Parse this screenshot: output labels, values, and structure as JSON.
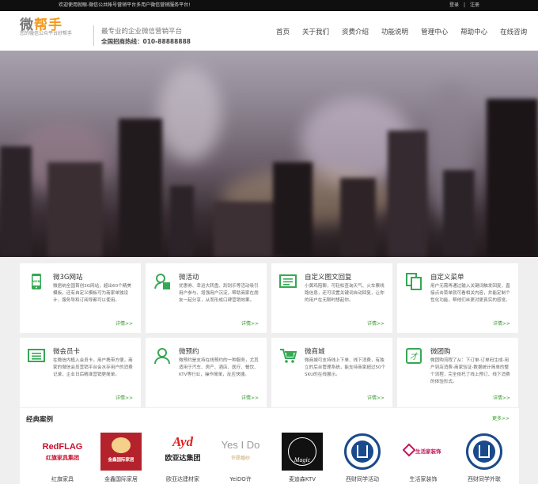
{
  "topbar": {
    "welcome": "欢迎使用就眼-微信公共帐号营销平台多用户微信营销服务平台!",
    "login": "登录",
    "separator": "|",
    "register": "注册"
  },
  "header": {
    "logo_part1": "微",
    "logo_part2": "帮手",
    "slogan": "您的微信公众平台好帮手",
    "tagline": "最专业的企业微信营销平台",
    "hotline": "全国招商热线：010-88888888"
  },
  "nav": [
    "首页",
    "关于我们",
    "资费介绍",
    "功能说明",
    "管理中心",
    "帮助中心",
    "在线咨询"
  ],
  "features": [
    {
      "icon": "phone-web-icon",
      "title": "微3G网站",
      "desc": "微居纳全国首创3G网站，超出60个精美模板，还有自定义模板可为商家单独设计，服务导和订阅导都可以使用。",
      "more": "详情>>"
    },
    {
      "icon": "user-activity-icon",
      "title": "微活动",
      "desc": "优惠券、幸运大转盘、刮刮乐等活动吸引用户参与、增强用户沉淀，帮助商家在朋友一起分享，从而形成口碑营销效果。",
      "more": "详情>>"
    },
    {
      "icon": "text-reply-icon",
      "title": "自定义图文回复",
      "desc": "小黄鸡陪聊，可轻松查询天气、火车票线路信息，还可设置关键词自动回复，让你的用户在无聊时想起你。",
      "more": "详情>>"
    },
    {
      "icon": "copy-menu-icon",
      "title": "自定义菜单",
      "desc": "用户无需再通过输入关键词触发回复，直接点击菜单就可看相关内容，并能定制个性化功能，帮他们丝更对更真实的感觉。",
      "more": "详情>>"
    },
    {
      "icon": "member-card-icon",
      "title": "微会员卡",
      "desc": "在微信内植入会员卡，用户携带方便，商家的微信会员营销平台会水存用户的消费记录，企业日后精准营销更简单。",
      "more": "详情>>"
    },
    {
      "icon": "reservation-icon",
      "title": "微预约",
      "desc": "微预约是支持在线预约的一种服务，尤其适用于汽车、房产、酒店、医疗、餐饮、KTV等行业，操作简单，反应快捷。",
      "more": "详情>>"
    },
    {
      "icon": "cart-icon",
      "title": "微商城",
      "desc": "微商城可支持线上下单、线下消费，有独立的后台管理系统，能支持商家超过50个SKU的在线展示。",
      "more": "详情>>"
    },
    {
      "icon": "group-buy-icon",
      "title": "微团购",
      "desc": "微团购流程了从：下订单-订单码生成-用户到店消费-商家验证-数据统计简单的整个流程，完全依托了线上预订、线下消费的体验形式。",
      "more": "详情>>"
    }
  ],
  "cases": {
    "heading": "经典案例",
    "more": "更多>>",
    "items": [
      {
        "name": "红旗家具",
        "logo_text_top": "RedFLAG",
        "logo_text_bottom": "红旗家具集团"
      },
      {
        "name": "金鑫国际家居",
        "logo_text_top": "金鑫国际家居"
      },
      {
        "name": "欧亚达建材家",
        "logo_text_top": "Ayd",
        "logo_text_bottom": "欧亚达集团"
      },
      {
        "name": "YeiDO许",
        "logo_text_top": "Yes I Do",
        "logo_text_bottom": "许愿婚纱"
      },
      {
        "name": "麦迪森KTV",
        "logo_text_top": "Magic"
      },
      {
        "name": "西财同学活动",
        "logo_text_top": ""
      },
      {
        "name": "生活家装饰",
        "logo_text_top": "生活家装饰"
      },
      {
        "name": "西财同学外联",
        "logo_text_top": ""
      }
    ]
  },
  "colors": {
    "accent": "#f39a1e",
    "link_green": "#3a9a2e",
    "icon_green": "#34a853",
    "topbar": "#0f0f0f"
  }
}
